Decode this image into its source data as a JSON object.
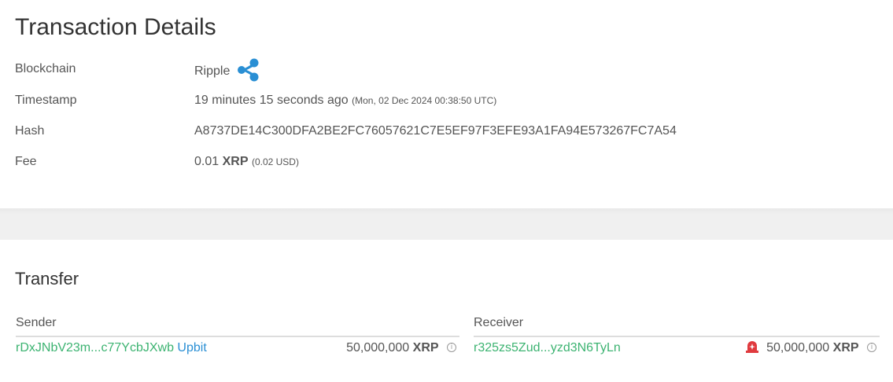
{
  "header": {
    "title": "Transaction Details"
  },
  "details": {
    "blockchain_label": "Blockchain",
    "blockchain_value": "Ripple",
    "blockchain_icon": "ripple-logo-icon",
    "timestamp_label": "Timestamp",
    "timestamp_relative": "19 minutes 15 seconds ago",
    "timestamp_absolute": "(Mon, 02 Dec 2024 00:38:50 UTC)",
    "hash_label": "Hash",
    "hash_value": "A8737DE14C300DFA2BE2FC76057621C7E5EF97F3EFE93A1FA94E573267FC7A54",
    "fee_label": "Fee",
    "fee_amount": "0.01",
    "fee_unit": "XRP",
    "fee_usd": "(0.02 USD)"
  },
  "transfer": {
    "title": "Transfer",
    "sender": {
      "header": "Sender",
      "address": "rDxJNbV23m...c77YcbJXwb",
      "tag": "Upbit",
      "amount": "50,000,000",
      "unit": "XRP",
      "info_icon_glyph": "i"
    },
    "receiver": {
      "header": "Receiver",
      "address": "r325zs5Zud...yzd3N6TyLn",
      "amount": "50,000,000",
      "unit": "XRP",
      "alert_icon": "alarm-siren-icon",
      "info_icon_glyph": "i"
    }
  },
  "colors": {
    "link_green": "#3cb371",
    "tag_blue": "#2a8fd4",
    "ripple_blue": "#2a8fd4",
    "alert_red": "#e03a3e"
  }
}
